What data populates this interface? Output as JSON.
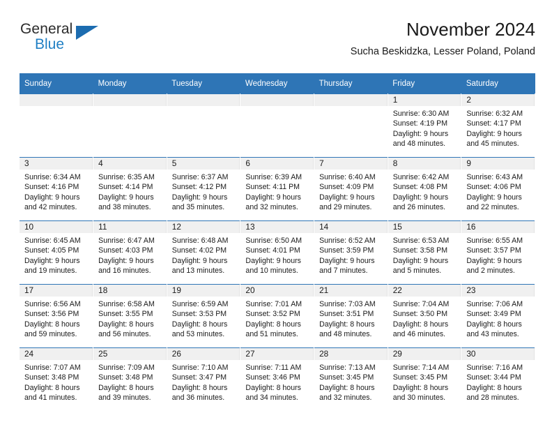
{
  "brand": {
    "name_part1": "General",
    "name_part2": "Blue",
    "triangle_color": "#1c6cb0",
    "blue_color": "#1f7fc4"
  },
  "header": {
    "title": "November 2024",
    "subtitle": "Sucha Beskidzka, Lesser Poland, Poland",
    "header_bg_color": "#2e75b6"
  },
  "weekdays": [
    "Sunday",
    "Monday",
    "Tuesday",
    "Wednesday",
    "Thursday",
    "Friday",
    "Saturday"
  ],
  "weeks": [
    [
      {
        "day": "",
        "empty": true
      },
      {
        "day": "",
        "empty": true
      },
      {
        "day": "",
        "empty": true
      },
      {
        "day": "",
        "empty": true
      },
      {
        "day": "",
        "empty": true
      },
      {
        "day": "1",
        "sunrise": "Sunrise: 6:30 AM",
        "sunset": "Sunset: 4:19 PM",
        "daylight": "Daylight: 9 hours and 48 minutes."
      },
      {
        "day": "2",
        "sunrise": "Sunrise: 6:32 AM",
        "sunset": "Sunset: 4:17 PM",
        "daylight": "Daylight: 9 hours and 45 minutes."
      }
    ],
    [
      {
        "day": "3",
        "sunrise": "Sunrise: 6:34 AM",
        "sunset": "Sunset: 4:16 PM",
        "daylight": "Daylight: 9 hours and 42 minutes."
      },
      {
        "day": "4",
        "sunrise": "Sunrise: 6:35 AM",
        "sunset": "Sunset: 4:14 PM",
        "daylight": "Daylight: 9 hours and 38 minutes."
      },
      {
        "day": "5",
        "sunrise": "Sunrise: 6:37 AM",
        "sunset": "Sunset: 4:12 PM",
        "daylight": "Daylight: 9 hours and 35 minutes."
      },
      {
        "day": "6",
        "sunrise": "Sunrise: 6:39 AM",
        "sunset": "Sunset: 4:11 PM",
        "daylight": "Daylight: 9 hours and 32 minutes."
      },
      {
        "day": "7",
        "sunrise": "Sunrise: 6:40 AM",
        "sunset": "Sunset: 4:09 PM",
        "daylight": "Daylight: 9 hours and 29 minutes."
      },
      {
        "day": "8",
        "sunrise": "Sunrise: 6:42 AM",
        "sunset": "Sunset: 4:08 PM",
        "daylight": "Daylight: 9 hours and 26 minutes."
      },
      {
        "day": "9",
        "sunrise": "Sunrise: 6:43 AM",
        "sunset": "Sunset: 4:06 PM",
        "daylight": "Daylight: 9 hours and 22 minutes."
      }
    ],
    [
      {
        "day": "10",
        "sunrise": "Sunrise: 6:45 AM",
        "sunset": "Sunset: 4:05 PM",
        "daylight": "Daylight: 9 hours and 19 minutes."
      },
      {
        "day": "11",
        "sunrise": "Sunrise: 6:47 AM",
        "sunset": "Sunset: 4:03 PM",
        "daylight": "Daylight: 9 hours and 16 minutes."
      },
      {
        "day": "12",
        "sunrise": "Sunrise: 6:48 AM",
        "sunset": "Sunset: 4:02 PM",
        "daylight": "Daylight: 9 hours and 13 minutes."
      },
      {
        "day": "13",
        "sunrise": "Sunrise: 6:50 AM",
        "sunset": "Sunset: 4:01 PM",
        "daylight": "Daylight: 9 hours and 10 minutes."
      },
      {
        "day": "14",
        "sunrise": "Sunrise: 6:52 AM",
        "sunset": "Sunset: 3:59 PM",
        "daylight": "Daylight: 9 hours and 7 minutes."
      },
      {
        "day": "15",
        "sunrise": "Sunrise: 6:53 AM",
        "sunset": "Sunset: 3:58 PM",
        "daylight": "Daylight: 9 hours and 5 minutes."
      },
      {
        "day": "16",
        "sunrise": "Sunrise: 6:55 AM",
        "sunset": "Sunset: 3:57 PM",
        "daylight": "Daylight: 9 hours and 2 minutes."
      }
    ],
    [
      {
        "day": "17",
        "sunrise": "Sunrise: 6:56 AM",
        "sunset": "Sunset: 3:56 PM",
        "daylight": "Daylight: 8 hours and 59 minutes."
      },
      {
        "day": "18",
        "sunrise": "Sunrise: 6:58 AM",
        "sunset": "Sunset: 3:55 PM",
        "daylight": "Daylight: 8 hours and 56 minutes."
      },
      {
        "day": "19",
        "sunrise": "Sunrise: 6:59 AM",
        "sunset": "Sunset: 3:53 PM",
        "daylight": "Daylight: 8 hours and 53 minutes."
      },
      {
        "day": "20",
        "sunrise": "Sunrise: 7:01 AM",
        "sunset": "Sunset: 3:52 PM",
        "daylight": "Daylight: 8 hours and 51 minutes."
      },
      {
        "day": "21",
        "sunrise": "Sunrise: 7:03 AM",
        "sunset": "Sunset: 3:51 PM",
        "daylight": "Daylight: 8 hours and 48 minutes."
      },
      {
        "day": "22",
        "sunrise": "Sunrise: 7:04 AM",
        "sunset": "Sunset: 3:50 PM",
        "daylight": "Daylight: 8 hours and 46 minutes."
      },
      {
        "day": "23",
        "sunrise": "Sunrise: 7:06 AM",
        "sunset": "Sunset: 3:49 PM",
        "daylight": "Daylight: 8 hours and 43 minutes."
      }
    ],
    [
      {
        "day": "24",
        "sunrise": "Sunrise: 7:07 AM",
        "sunset": "Sunset: 3:48 PM",
        "daylight": "Daylight: 8 hours and 41 minutes."
      },
      {
        "day": "25",
        "sunrise": "Sunrise: 7:09 AM",
        "sunset": "Sunset: 3:48 PM",
        "daylight": "Daylight: 8 hours and 39 minutes."
      },
      {
        "day": "26",
        "sunrise": "Sunrise: 7:10 AM",
        "sunset": "Sunset: 3:47 PM",
        "daylight": "Daylight: 8 hours and 36 minutes."
      },
      {
        "day": "27",
        "sunrise": "Sunrise: 7:11 AM",
        "sunset": "Sunset: 3:46 PM",
        "daylight": "Daylight: 8 hours and 34 minutes."
      },
      {
        "day": "28",
        "sunrise": "Sunrise: 7:13 AM",
        "sunset": "Sunset: 3:45 PM",
        "daylight": "Daylight: 8 hours and 32 minutes."
      },
      {
        "day": "29",
        "sunrise": "Sunrise: 7:14 AM",
        "sunset": "Sunset: 3:45 PM",
        "daylight": "Daylight: 8 hours and 30 minutes."
      },
      {
        "day": "30",
        "sunrise": "Sunrise: 7:16 AM",
        "sunset": "Sunset: 3:44 PM",
        "daylight": "Daylight: 8 hours and 28 minutes."
      }
    ]
  ]
}
